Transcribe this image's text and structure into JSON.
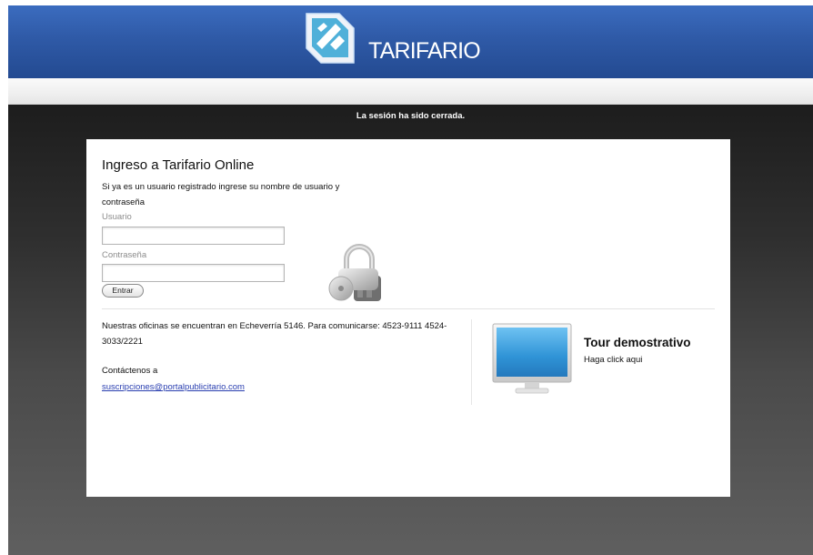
{
  "header": {
    "brand": "TARIFARIO",
    "logo_icon": "tarifario-logo-icon"
  },
  "banner": {
    "session_message": "La sesión ha sido cerrada."
  },
  "login": {
    "title": "Ingreso a Tarifario Online",
    "description": "Si ya es un usuario registrado ingrese su nombre de usuario y contraseña",
    "username_label": "Usuario",
    "username_value": "",
    "password_label": "Contraseña",
    "password_value": "",
    "submit_label": "Entrar",
    "icon": "padlock-keys-icon"
  },
  "info": {
    "offices_text": "Nuestras oficinas se encuentran en Echeverría 5146. Para comunicarse: 4523-9111 4524-3033/2221",
    "contact_label": "Contáctenos a",
    "contact_email": "suscripciones@portalpublicitario.com"
  },
  "tour": {
    "title": "Tour demostrativo",
    "link": "Haga click aqui",
    "icon": "monitor-icon"
  },
  "colors": {
    "header_blue": "#2f5aa7",
    "link_blue": "#2a3fb0",
    "background_dark": "#2f2f2f"
  }
}
